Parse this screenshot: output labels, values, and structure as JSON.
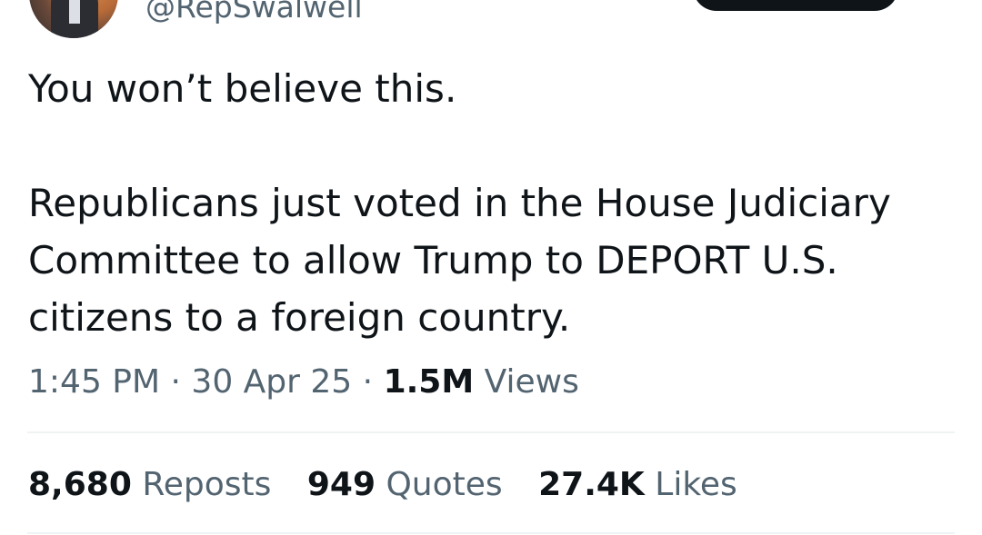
{
  "author": {
    "handle": "@RepSwalwell"
  },
  "tweet": {
    "paragraphs": [
      "You won’t believe this.",
      "Republicans just voted in the House Judiciary Committee to allow Trump to DEPORT U.S. citizens to a foreign country."
    ]
  },
  "meta": {
    "time": "1:45 PM",
    "separator": "·",
    "date": "30 Apr 25",
    "views_count": "1.5M",
    "views_label": "Views"
  },
  "stats": [
    {
      "count": "8,680",
      "label": "Reposts"
    },
    {
      "count": "949",
      "label": "Quotes"
    },
    {
      "count": "27.4K",
      "label": "Likes"
    }
  ],
  "colors": {
    "text_primary": "#0f1419",
    "text_secondary": "#536471",
    "divider": "#eff3f4",
    "follow_button_bg": "#0f1419"
  }
}
